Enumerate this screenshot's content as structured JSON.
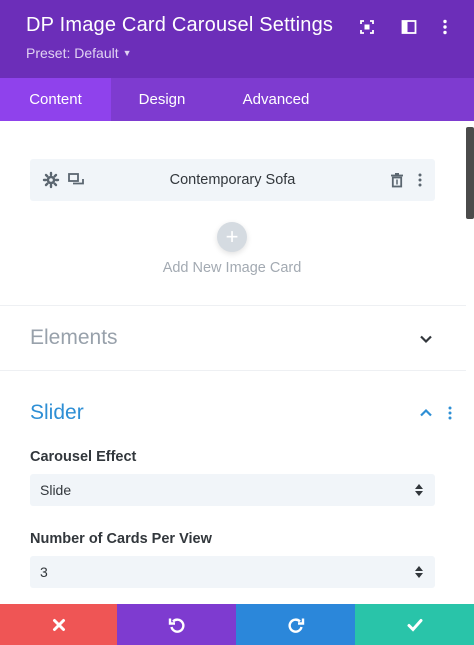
{
  "header": {
    "title": "DP Image Card Carousel Settings",
    "preset": "Preset: Default",
    "icons": [
      "fullscreen-icon",
      "sidebar-layout-icon",
      "more-vertical-icon"
    ],
    "bg_color": "#6c2eb9"
  },
  "tabs": [
    {
      "label": "Content",
      "active": true
    },
    {
      "label": "Design",
      "active": false
    },
    {
      "label": "Advanced",
      "active": false
    }
  ],
  "cards": {
    "items": [
      {
        "title": "Contemporary Sofa"
      }
    ],
    "add_label": "Add New Image Card"
  },
  "sections": {
    "elements": {
      "title": "Elements",
      "expanded": false
    },
    "slider": {
      "title": "Slider",
      "expanded": true,
      "fields": {
        "carousel_effect": {
          "label": "Carousel Effect",
          "value": "Slide"
        },
        "cards_per_view": {
          "label": "Number of Cards Per View",
          "value": "3"
        }
      }
    }
  },
  "footer": {
    "buttons": [
      {
        "name": "cancel",
        "icon": "close-icon",
        "color": "#ef5555"
      },
      {
        "name": "undo",
        "icon": "undo-icon",
        "color": "#7e3bd0"
      },
      {
        "name": "redo",
        "icon": "redo-icon",
        "color": "#2b87da"
      },
      {
        "name": "save",
        "icon": "check-icon",
        "color": "#29c4a9"
      }
    ]
  },
  "colors": {
    "accent": "#2e8fd5",
    "tab_active": "#8f42ec",
    "tabs_bg": "#7e3bd0"
  }
}
